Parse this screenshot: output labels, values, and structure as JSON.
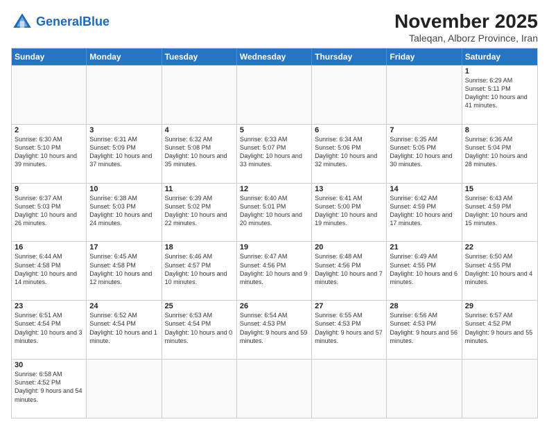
{
  "logo": {
    "text_general": "General",
    "text_blue": "Blue"
  },
  "header": {
    "month_year": "November 2025",
    "location": "Taleqan, Alborz Province, Iran"
  },
  "weekdays": [
    "Sunday",
    "Monday",
    "Tuesday",
    "Wednesday",
    "Thursday",
    "Friday",
    "Saturday"
  ],
  "rows": [
    [
      {
        "day": "",
        "empty": true
      },
      {
        "day": "",
        "empty": true
      },
      {
        "day": "",
        "empty": true
      },
      {
        "day": "",
        "empty": true
      },
      {
        "day": "",
        "empty": true
      },
      {
        "day": "",
        "empty": true
      },
      {
        "day": "1",
        "sunrise": "6:29 AM",
        "sunset": "5:11 PM",
        "daylight": "10 hours and 41 minutes."
      }
    ],
    [
      {
        "day": "2",
        "sunrise": "6:30 AM",
        "sunset": "5:10 PM",
        "daylight": "10 hours and 39 minutes."
      },
      {
        "day": "3",
        "sunrise": "6:31 AM",
        "sunset": "5:09 PM",
        "daylight": "10 hours and 37 minutes."
      },
      {
        "day": "4",
        "sunrise": "6:32 AM",
        "sunset": "5:08 PM",
        "daylight": "10 hours and 35 minutes."
      },
      {
        "day": "5",
        "sunrise": "6:33 AM",
        "sunset": "5:07 PM",
        "daylight": "10 hours and 33 minutes."
      },
      {
        "day": "6",
        "sunrise": "6:34 AM",
        "sunset": "5:06 PM",
        "daylight": "10 hours and 32 minutes."
      },
      {
        "day": "7",
        "sunrise": "6:35 AM",
        "sunset": "5:05 PM",
        "daylight": "10 hours and 30 minutes."
      },
      {
        "day": "8",
        "sunrise": "6:36 AM",
        "sunset": "5:04 PM",
        "daylight": "10 hours and 28 minutes."
      }
    ],
    [
      {
        "day": "9",
        "sunrise": "6:37 AM",
        "sunset": "5:03 PM",
        "daylight": "10 hours and 26 minutes."
      },
      {
        "day": "10",
        "sunrise": "6:38 AM",
        "sunset": "5:03 PM",
        "daylight": "10 hours and 24 minutes."
      },
      {
        "day": "11",
        "sunrise": "6:39 AM",
        "sunset": "5:02 PM",
        "daylight": "10 hours and 22 minutes."
      },
      {
        "day": "12",
        "sunrise": "6:40 AM",
        "sunset": "5:01 PM",
        "daylight": "10 hours and 20 minutes."
      },
      {
        "day": "13",
        "sunrise": "6:41 AM",
        "sunset": "5:00 PM",
        "daylight": "10 hours and 19 minutes."
      },
      {
        "day": "14",
        "sunrise": "6:42 AM",
        "sunset": "4:59 PM",
        "daylight": "10 hours and 17 minutes."
      },
      {
        "day": "15",
        "sunrise": "6:43 AM",
        "sunset": "4:59 PM",
        "daylight": "10 hours and 15 minutes."
      }
    ],
    [
      {
        "day": "16",
        "sunrise": "6:44 AM",
        "sunset": "4:58 PM",
        "daylight": "10 hours and 14 minutes."
      },
      {
        "day": "17",
        "sunrise": "6:45 AM",
        "sunset": "4:58 PM",
        "daylight": "10 hours and 12 minutes."
      },
      {
        "day": "18",
        "sunrise": "6:46 AM",
        "sunset": "4:57 PM",
        "daylight": "10 hours and 10 minutes."
      },
      {
        "day": "19",
        "sunrise": "6:47 AM",
        "sunset": "4:56 PM",
        "daylight": "10 hours and 9 minutes."
      },
      {
        "day": "20",
        "sunrise": "6:48 AM",
        "sunset": "4:56 PM",
        "daylight": "10 hours and 7 minutes."
      },
      {
        "day": "21",
        "sunrise": "6:49 AM",
        "sunset": "4:55 PM",
        "daylight": "10 hours and 6 minutes."
      },
      {
        "day": "22",
        "sunrise": "6:50 AM",
        "sunset": "4:55 PM",
        "daylight": "10 hours and 4 minutes."
      }
    ],
    [
      {
        "day": "23",
        "sunrise": "6:51 AM",
        "sunset": "4:54 PM",
        "daylight": "10 hours and 3 minutes."
      },
      {
        "day": "24",
        "sunrise": "6:52 AM",
        "sunset": "4:54 PM",
        "daylight": "10 hours and 1 minute."
      },
      {
        "day": "25",
        "sunrise": "6:53 AM",
        "sunset": "4:54 PM",
        "daylight": "10 hours and 0 minutes."
      },
      {
        "day": "26",
        "sunrise": "6:54 AM",
        "sunset": "4:53 PM",
        "daylight": "9 hours and 59 minutes."
      },
      {
        "day": "27",
        "sunrise": "6:55 AM",
        "sunset": "4:53 PM",
        "daylight": "9 hours and 57 minutes."
      },
      {
        "day": "28",
        "sunrise": "6:56 AM",
        "sunset": "4:53 PM",
        "daylight": "9 hours and 56 minutes."
      },
      {
        "day": "29",
        "sunrise": "6:57 AM",
        "sunset": "4:52 PM",
        "daylight": "9 hours and 55 minutes."
      }
    ],
    [
      {
        "day": "30",
        "sunrise": "6:58 AM",
        "sunset": "4:52 PM",
        "daylight": "9 hours and 54 minutes."
      },
      {
        "day": "",
        "empty": true
      },
      {
        "day": "",
        "empty": true
      },
      {
        "day": "",
        "empty": true
      },
      {
        "day": "",
        "empty": true
      },
      {
        "day": "",
        "empty": true
      },
      {
        "day": "",
        "empty": true
      }
    ]
  ]
}
